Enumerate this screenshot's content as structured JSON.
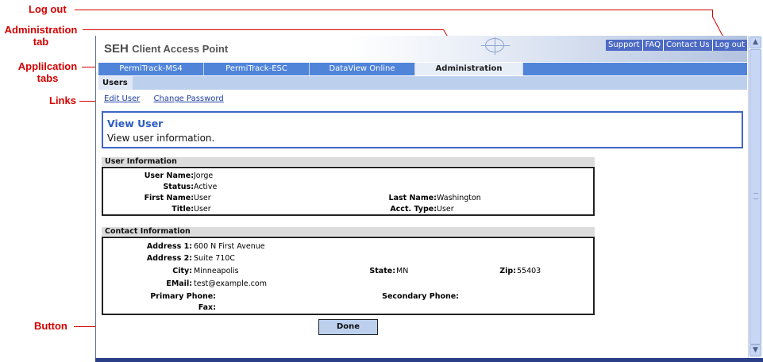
{
  "callouts": {
    "logout": "Log out",
    "admin_tab_line1": "Administration",
    "admin_tab_line2": "tab",
    "app_tabs_line1": "Applilcation",
    "app_tabs_line2": "tabs",
    "links": "Links",
    "button": "Button"
  },
  "header": {
    "brand_seh": "SEH",
    "brand_cap": "Client Access Point",
    "top_links": [
      "Support",
      "FAQ",
      "Contact Us",
      "Log out"
    ]
  },
  "app_tabs": [
    "PermiTrack-MS4",
    "PermiTrack-ESC",
    "DataView Online",
    "Administration"
  ],
  "active_app_tab": "Administration",
  "sub_tabs": [
    "Users"
  ],
  "links": [
    "Edit User",
    "Change Password"
  ],
  "panel": {
    "title": "View User",
    "description": "View user information."
  },
  "user_info": {
    "heading": "User Information",
    "user_name_label": "User Name:",
    "user_name": "Jorge",
    "status_label": "Status:",
    "status": "Active",
    "first_name_label": "First Name:",
    "first_name": "User",
    "last_name_label": "Last Name:",
    "last_name": "Washington",
    "title_label": "Title:",
    "title": "User",
    "acct_type_label": "Acct. Type:",
    "acct_type": "User"
  },
  "contact_info": {
    "heading": "Contact Information",
    "address1_label": "Address 1:",
    "address1": "600 N First Avenue",
    "address2_label": "Address 2:",
    "address2": "Suite 710C",
    "city_label": "City:",
    "city": "Minneapolis",
    "state_label": "State:",
    "state": "MN",
    "zip_label": "Zip:",
    "zip": "55403",
    "email_label": "EMail:",
    "email": "test@example.com",
    "primary_phone_label": "Primary Phone:",
    "primary_phone": "",
    "secondary_phone_label": "Secondary Phone:",
    "secondary_phone": "",
    "fax_label": "Fax:",
    "fax": ""
  },
  "done_button": "Done",
  "colors": {
    "annotation": "#d40000",
    "app_tab_bar": "#4f84d9",
    "subtab_bar": "#bcd0ee",
    "panel_border": "#3d67c4",
    "link": "#1e3fa0"
  }
}
